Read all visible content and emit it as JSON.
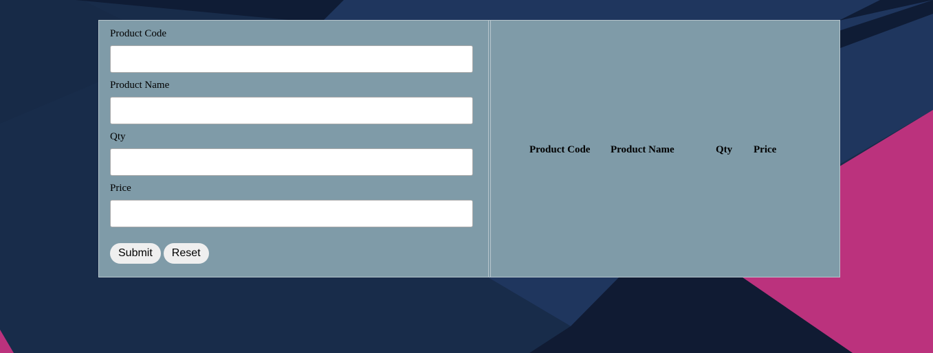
{
  "form": {
    "fields": [
      {
        "label": "Product Code",
        "value": "",
        "placeholder": ""
      },
      {
        "label": "Product Name",
        "value": "",
        "placeholder": ""
      },
      {
        "label": "Qty",
        "value": "",
        "placeholder": ""
      },
      {
        "label": "Price",
        "value": "",
        "placeholder": ""
      }
    ],
    "submit_label": "Submit",
    "reset_label": "Reset"
  },
  "table": {
    "headers": [
      "Product Code",
      "Product Name",
      "Qty",
      "Price"
    ]
  },
  "colors": {
    "background_dark": "#182c4a",
    "background_navy": "#1f365e",
    "background_darkest": "#101b33",
    "accent_pink": "#bb327d",
    "panel": "#7f9ba8",
    "panel_border": "#b7c6cd",
    "button_bg": "#efefef"
  }
}
